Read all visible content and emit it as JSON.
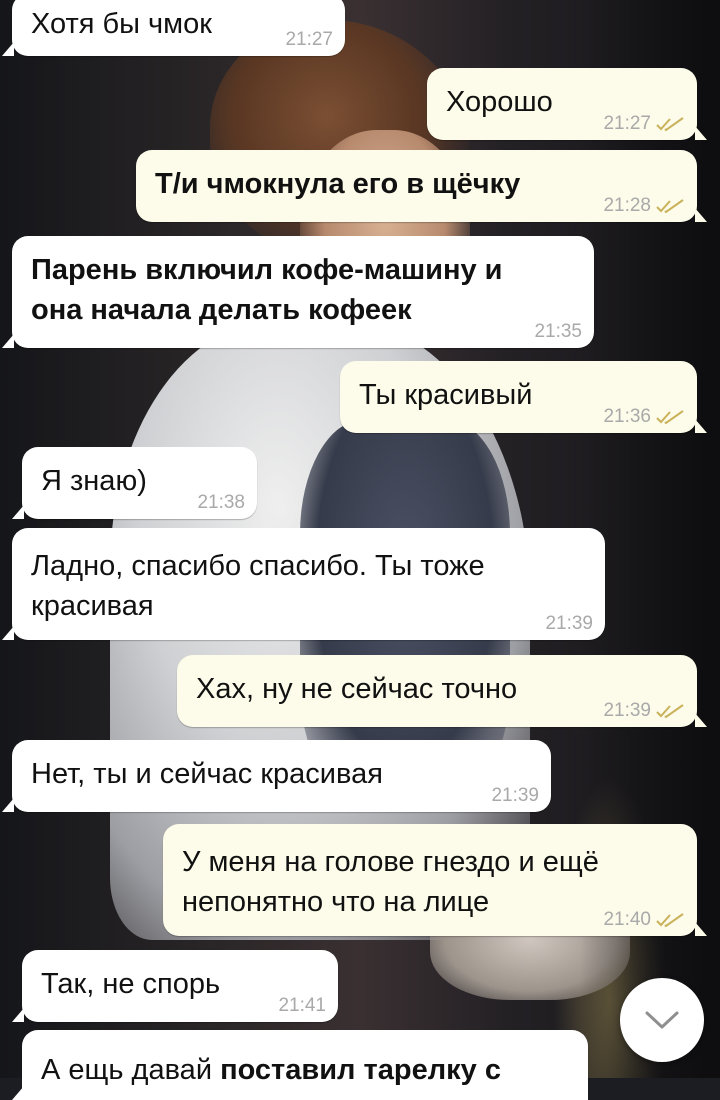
{
  "messages": [
    {
      "direction": "in",
      "text": "Хотя бы чмок",
      "time": "21:27",
      "read": false,
      "bold": false
    },
    {
      "direction": "out",
      "text": "Хорошо",
      "time": "21:27",
      "read": true,
      "bold": false
    },
    {
      "direction": "out",
      "text": "Т/и чмокнула его в щёчку",
      "time": "21:28",
      "read": true,
      "bold": true
    },
    {
      "direction": "in",
      "text": "Парень включил кофе-машину и\nона начала делать кофеек",
      "time": "21:35",
      "read": false,
      "bold": true
    },
    {
      "direction": "out",
      "text": "Ты красивый",
      "time": "21:36",
      "read": true,
      "bold": false
    },
    {
      "direction": "in",
      "text": "Я знаю)",
      "time": "21:38",
      "read": false,
      "bold": false
    },
    {
      "direction": "in",
      "text": "Ладно, спасибо спасибо. Ты тоже\nкрасивая",
      "time": "21:39",
      "read": false,
      "bold": false
    },
    {
      "direction": "out",
      "text": "Хах, ну не сейчас точно",
      "time": "21:39",
      "read": true,
      "bold": false
    },
    {
      "direction": "in",
      "text": "Нет, ты и сейчас красивая",
      "time": "21:39",
      "read": false,
      "bold": false
    },
    {
      "direction": "out",
      "text": "У меня на голове гнездо и ещё\nнепонятно что на лице",
      "time": "21:40",
      "read": true,
      "bold": false
    },
    {
      "direction": "in",
      "text": "Так, не спорь",
      "time": "21:41",
      "read": false,
      "bold": false
    },
    {
      "direction": "in",
      "text_plain": "А ещь давай ",
      "text_bold": "поставил тарелку с",
      "time": "",
      "read": false
    }
  ],
  "colors": {
    "incoming_bubble": "#ffffff",
    "outgoing_bubble": "#fdfbe9",
    "timestamp": "#a9a9a9",
    "read_ticks": "#c9b25a"
  },
  "scroll_button": {
    "icon": "chevron-down-icon"
  }
}
